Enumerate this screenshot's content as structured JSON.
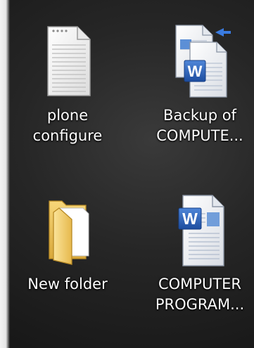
{
  "desktop": {
    "icons": [
      {
        "line1": "plone",
        "line2": "configure",
        "type": "text-file-icon"
      },
      {
        "line1": "Backup of",
        "line2": "COMPUTE...",
        "type": "word-backup-icon"
      },
      {
        "line1": "New folder",
        "line2": "",
        "type": "folder-icon"
      },
      {
        "line1": "COMPUTER",
        "line2": "PROGRAM...",
        "type": "word-document-icon"
      }
    ]
  },
  "colors": {
    "label_text": "#ffffff",
    "word_blue": "#2b5fb4",
    "folder_yellow": "#f3cf6a"
  }
}
